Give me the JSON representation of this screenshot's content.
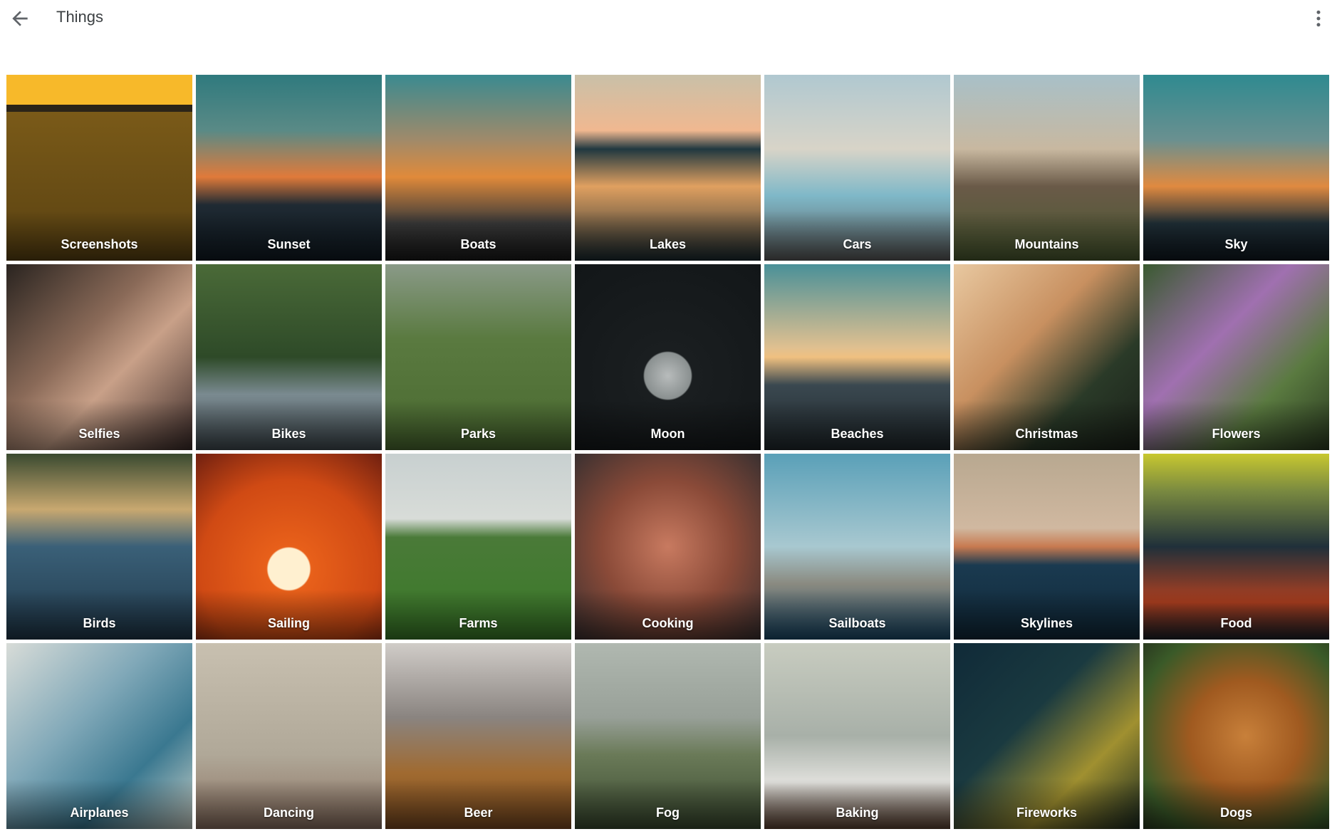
{
  "header": {
    "title": "Things",
    "back_icon": "arrow-back-icon",
    "menu_icon": "more-vert-icon"
  },
  "tiles": [
    {
      "label": "Screenshots",
      "bg": "linear-gradient(#f7b92a 0%,#f7b92a 16%,#2b2418 16%,#2b2418 20%,#7a5a18 20%,#5a4212 100%)"
    },
    {
      "label": "Sunset",
      "bg": "linear-gradient(#2f7a7e 0%,#5a8a86 30%,#e07a3a 55%,#1f2a33 70%,#101a22 100%)"
    },
    {
      "label": "Boats",
      "bg": "linear-gradient(#3a8a90 0%,#a08a6a 35%,#e08a3a 55%,#3a3a3a 80%,#1a1a1a 100%)"
    },
    {
      "label": "Lakes",
      "bg": "linear-gradient(#c9c0a8 0%,#f0b890 30%,#203840 40%,#e0a060 60%,#1a2a30 100%)"
    },
    {
      "label": "Cars",
      "bg": "linear-gradient(#b0c8d0 0%,#d8d4c8 40%,#7fb8c8 65%,#5a5a5a 100%)"
    },
    {
      "label": "Mountains",
      "bg": "linear-gradient(#a8c0c8 0%,#c8b8a0 40%,#6a5a48 60%,#4a5a30 100%)"
    },
    {
      "label": "Sky",
      "bg": "linear-gradient(#2f8a90 0%,#6a9090 35%,#e08a40 60%,#203038 80%,#101820 100%)"
    },
    {
      "label": "Selfies",
      "bg": "linear-gradient(135deg,#2a2420 0%,#8a6a58 40%,#c8a088 60%,#3a2a28 100%)"
    },
    {
      "label": "Bikes",
      "bg": "linear-gradient(#4a6a38 0%,#2e4a28 50%,#7a8a90 70%,#404a50 100%)"
    },
    {
      "label": "Parks",
      "bg": "linear-gradient(#8a9a88 0%,#5a7a40 40%,#4a6a30 100%)"
    },
    {
      "label": "Moon",
      "bg": "radial-gradient(circle at 50% 60%,#b8bcbc 0,#8a9090 16%,#1a1e20 17%,#121618 100%)"
    },
    {
      "label": "Beaches",
      "bg": "linear-gradient(#4a9098 0%,#e0c090 45%,#f0c080 50%,#3a4850 65%,#20282c 100%)"
    },
    {
      "label": "Christmas",
      "bg": "linear-gradient(135deg,#e8c8a0 0%,#c89060 40%,#2a3a28 70%,#1a2018 100%)"
    },
    {
      "label": "Flowers",
      "bg": "linear-gradient(135deg,#3a5a30 0%,#a070b0 40%,#5a7a40 70%,#2a3a20 100%)"
    },
    {
      "label": "Birds",
      "bg": "linear-gradient(#3a4a30 0%,#c8a870 30%,#3a6078 50%,#20384a 100%)"
    },
    {
      "label": "Sailing",
      "bg": "radial-gradient(circle at 50% 62%,#fff0d0 0,#fff0d0 14%,#e8601a 15%,#d04a14 60%,#702010 100%)"
    },
    {
      "label": "Farms",
      "bg": "linear-gradient(#c8d0d0 0%,#d8dcd8 35%,#4a7a38 45%,#3a7a28 100%)"
    },
    {
      "label": "Cooking",
      "bg": "radial-gradient(circle at 50% 50%,#c87a60 0,#8a4a38 50%,#3a3030 100%)"
    },
    {
      "label": "Sailboats",
      "bg": "linear-gradient(#5aa0b8 0%,#a8c8d0 50%,#8a8a80 70%,#1a4a6a 100%)"
    },
    {
      "label": "Skylines",
      "bg": "linear-gradient(#b8a890 0%,#d0b8a0 40%,#c87a50 50%,#1a3a50 60%,#102838 100%)"
    },
    {
      "label": "Food",
      "bg": "linear-gradient(#c8c830 0%,#7a8a40 20%,#20303a 50%,#b04020 80%,#1a2028 100%)"
    },
    {
      "label": "Airplanes",
      "bg": "linear-gradient(135deg,#d8dcd8 0%,#80a8b8 40%,#3a7890 70%,#c8d0c8 100%)"
    },
    {
      "label": "Dancing",
      "bg": "linear-gradient(#c8c0b0 0%,#b0a898 60%,#8a7060 100%)"
    },
    {
      "label": "Beer",
      "bg": "linear-gradient(#d0ccc8 0%,#8a8480 40%,#a06a30 70%,#7a4a20 100%)"
    },
    {
      "label": "Fog",
      "bg": "linear-gradient(#b0b8b0 0%,#98a098 40%,#6a7a58 60%,#3a4a30 100%)"
    },
    {
      "label": "Baking",
      "bg": "linear-gradient(#c8ccc0 0%,#a8b0a8 50%,#e0e0dc 75%,#5a4030 100%)"
    },
    {
      "label": "Fireworks",
      "bg": "linear-gradient(135deg,#102a38 0%,#1a3a40 40%,#a09030 70%,#1a2a20 100%)"
    },
    {
      "label": "Dogs",
      "bg": "radial-gradient(circle at 55% 50%,#c8803a 0,#a05a20 40%,#3a5a28 80%,#2a3a20 100%)"
    }
  ]
}
